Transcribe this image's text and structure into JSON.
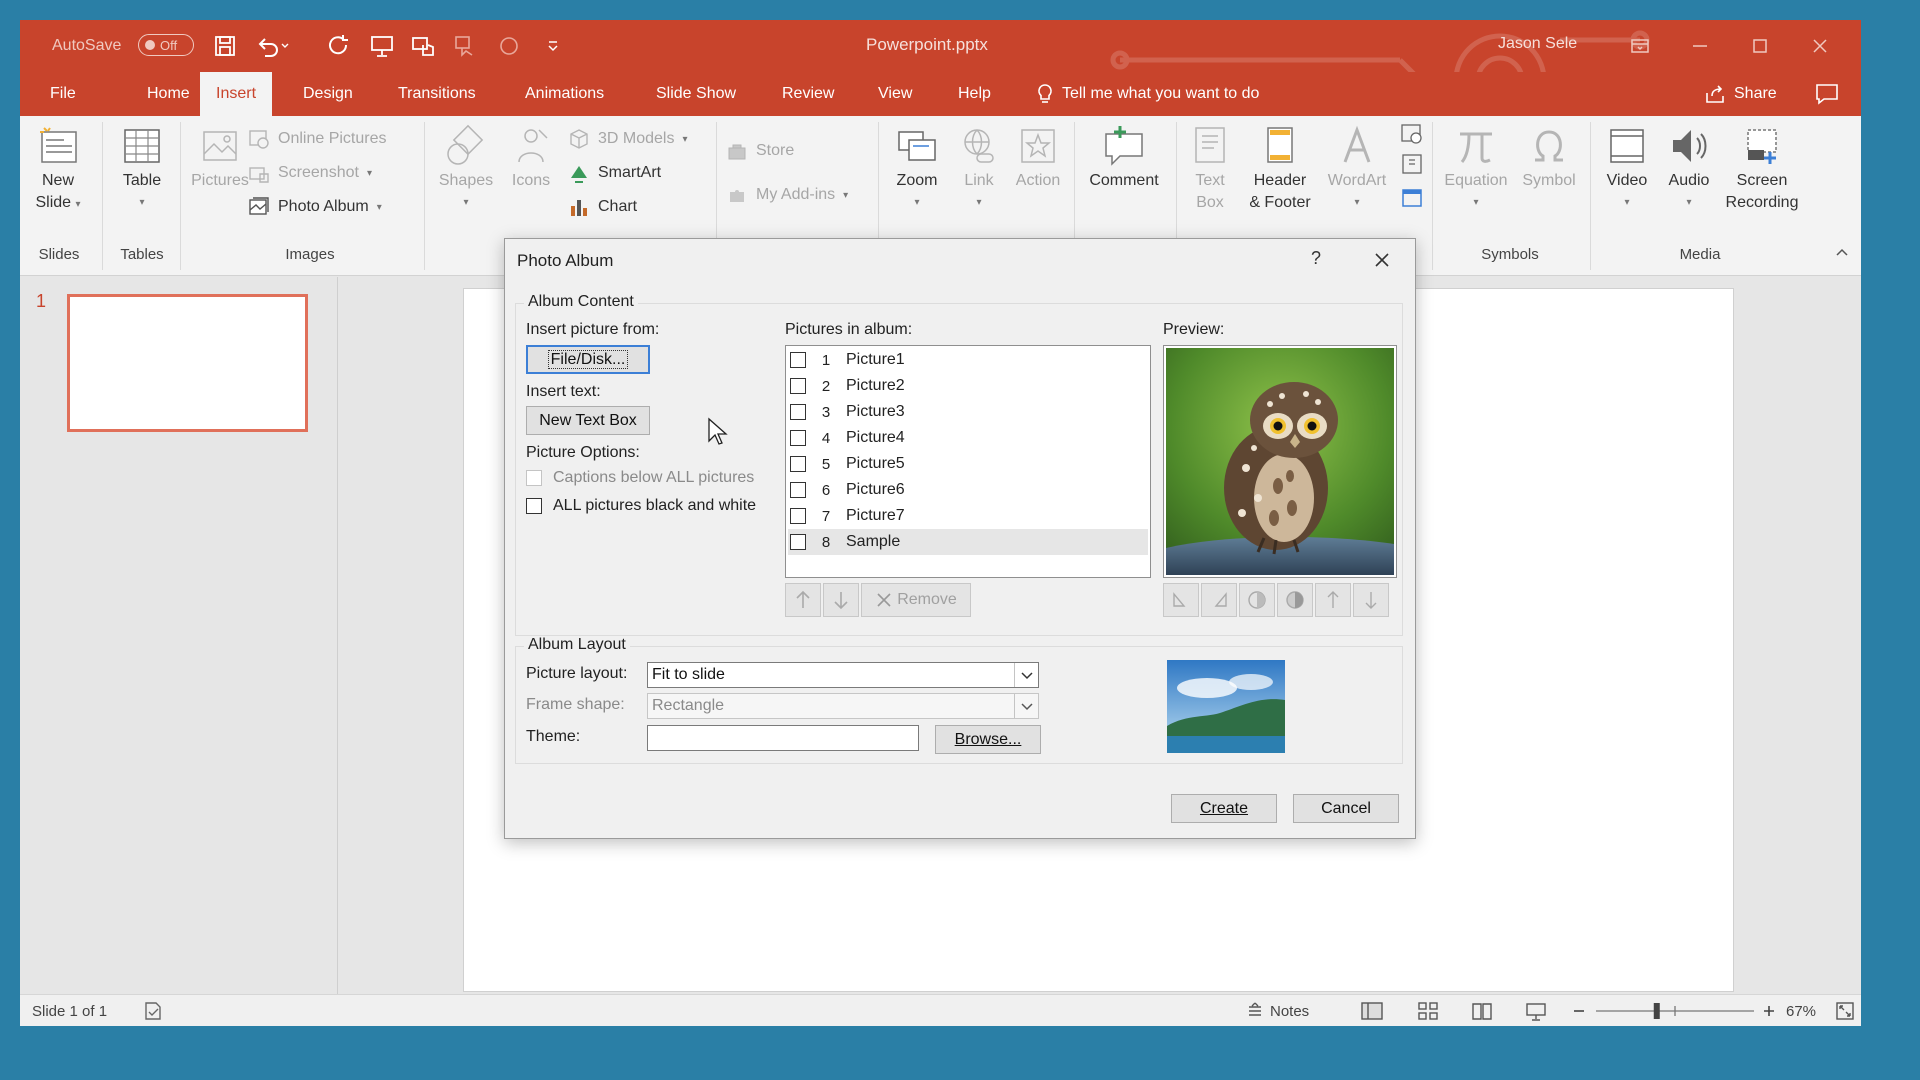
{
  "window": {
    "autosave_label": "AutoSave",
    "autosave_state": "Off",
    "doc_title": "Powerpoint.pptx",
    "user_name": "Jason Sele",
    "accent": "#c8442c"
  },
  "tabs": [
    "File",
    "Home",
    "Insert",
    "Design",
    "Transitions",
    "Animations",
    "Slide Show",
    "Review",
    "View",
    "Help"
  ],
  "active_tab": "Insert",
  "tellme": "Tell me what you want to do",
  "share": "Share",
  "ribbon": {
    "new_slide": [
      "New",
      "Slide"
    ],
    "table": "Table",
    "pictures": "Pictures",
    "online_pictures": "Online Pictures",
    "screenshot": "Screenshot",
    "photo_album": "Photo Album",
    "shapes": "Shapes",
    "icons": "Icons",
    "models_3d": "3D Models",
    "smartart": "SmartArt",
    "chart": "Chart",
    "store": "Store",
    "my_addins": "My Add-ins",
    "zoom": "Zoom",
    "link": "Link",
    "action": "Action",
    "comment": "Comment",
    "text_box": [
      "Text",
      "Box"
    ],
    "header_footer": [
      "Header",
      "& Footer"
    ],
    "wordart": "WordArt",
    "equation": "Equation",
    "symbol": "Symbol",
    "video": "Video",
    "audio": "Audio",
    "screen_recording": [
      "Screen",
      "Recording"
    ],
    "groups": {
      "slides": "Slides",
      "tables": "Tables",
      "images": "Images",
      "symbols": "Symbols",
      "media": "Media"
    }
  },
  "slide_panel": {
    "slide_number": "1"
  },
  "status": {
    "slide_info": "Slide 1 of 1",
    "notes": "Notes",
    "zoom_level": "67%",
    "zoom_fraction": 0.38
  },
  "dialog": {
    "title": "Photo Album",
    "help": "?",
    "album_content": "Album Content",
    "insert_picture_from": "Insert picture from:",
    "file_disk": "File/Disk...",
    "insert_text": "Insert text:",
    "new_text_box": "New Text Box",
    "picture_options": "Picture Options:",
    "captions_below": "Captions below ALL pictures",
    "all_black_white": "ALL pictures black and white",
    "pictures_in_album": "Pictures in album:",
    "pictures": [
      {
        "num": "1",
        "name": "Picture1"
      },
      {
        "num": "2",
        "name": "Picture2"
      },
      {
        "num": "3",
        "name": "Picture3"
      },
      {
        "num": "4",
        "name": "Picture4"
      },
      {
        "num": "5",
        "name": "Picture5"
      },
      {
        "num": "6",
        "name": "Picture6"
      },
      {
        "num": "7",
        "name": "Picture7"
      },
      {
        "num": "8",
        "name": "Sample"
      }
    ],
    "selected_picture": "Sample",
    "remove": "Remove",
    "preview": "Preview:",
    "album_layout": "Album Layout",
    "picture_layout_label": "Picture layout:",
    "picture_layout_value": "Fit to slide",
    "frame_shape_label": "Frame shape:",
    "frame_shape_value": "Rectangle",
    "theme_label": "Theme:",
    "theme_value": "",
    "browse": "Browse...",
    "create": "Create",
    "cancel": "Cancel"
  }
}
